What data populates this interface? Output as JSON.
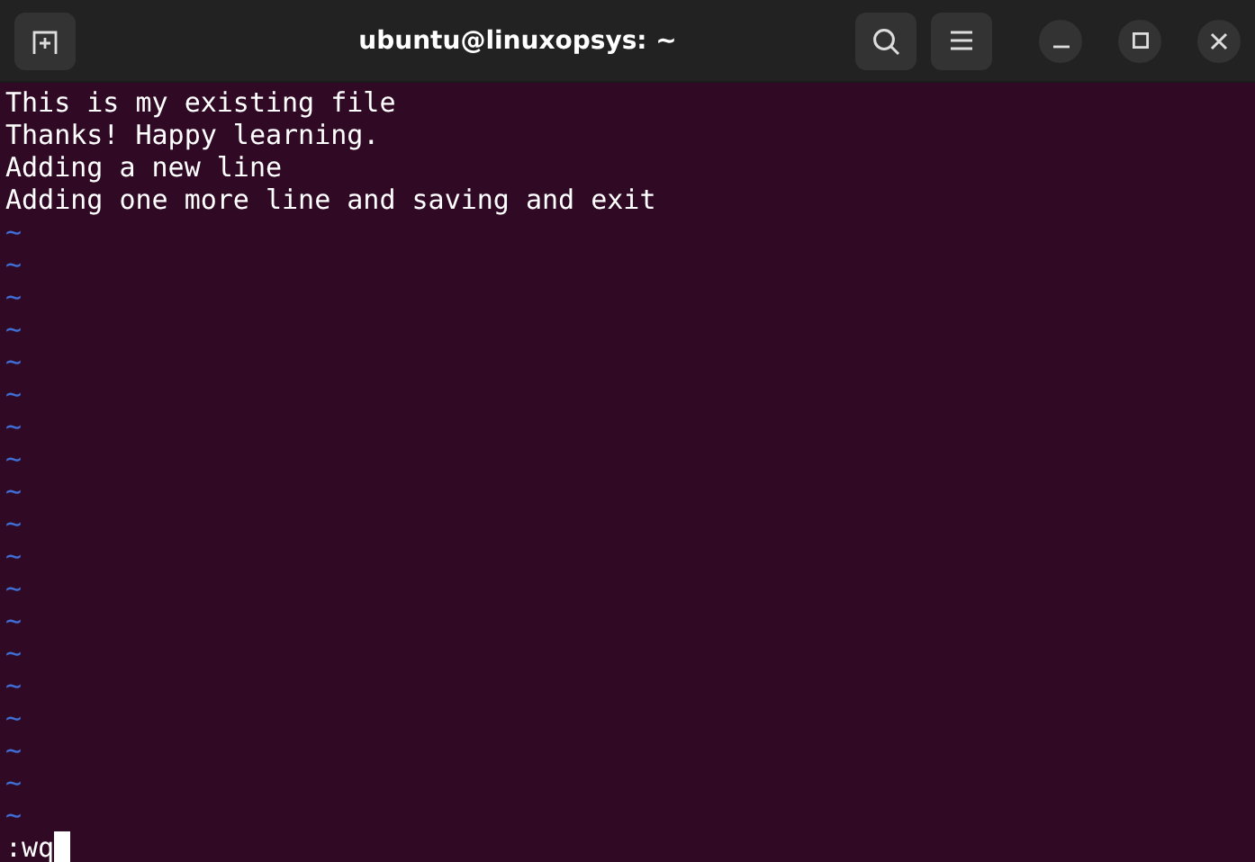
{
  "window": {
    "title": "ubuntu@linuxopsys: ~"
  },
  "buffer": {
    "lines": [
      "This is my existing file",
      "Thanks! Happy learning.",
      "Adding a new line",
      "Adding one more line and saving and exit"
    ],
    "empty_markers": [
      "~",
      "~",
      "~",
      "~",
      "~",
      "~",
      "~",
      "~",
      "~",
      "~",
      "~",
      "~",
      "~",
      "~",
      "~",
      "~",
      "~",
      "~",
      "~"
    ],
    "command_line": ":wq"
  }
}
